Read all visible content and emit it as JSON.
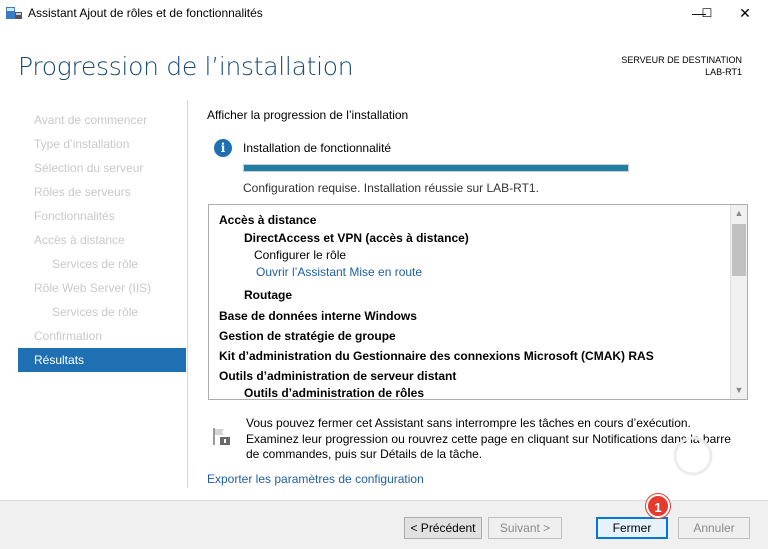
{
  "window": {
    "title": "Assistant Ajout de rôles et de fonctionnalités",
    "minimize": "—",
    "maximize": "☐",
    "close": "✕"
  },
  "header": {
    "title": "Progression de l’installation",
    "dest_label": "SERVEUR DE DESTINATION",
    "dest_server": "LAB-RT1"
  },
  "nav": {
    "items": [
      {
        "label": "Avant de commencer"
      },
      {
        "label": "Type d’installation"
      },
      {
        "label": "Sélection du serveur"
      },
      {
        "label": "Rôles de serveurs"
      },
      {
        "label": "Fonctionnalités"
      },
      {
        "label": "Accès à distance"
      },
      {
        "label": "Services de rôle"
      },
      {
        "label": "Rôle Web Server (IIS)"
      },
      {
        "label": "Services de rôle"
      },
      {
        "label": "Confirmation"
      },
      {
        "label": "Résultats"
      }
    ]
  },
  "main": {
    "section_label": "Afficher la progression de l’installation",
    "info_title": "Installation de fonctionnalité",
    "progress": 1.0,
    "status": "Configuration requise. Installation réussie sur LAB-RT1.",
    "results": [
      {
        "text": "Accès à distance"
      },
      {
        "text": "DirectAccess et VPN (accès à distance)"
      },
      {
        "text": "Configurer le rôle"
      },
      {
        "text": "Ouvrir l’Assistant Mise en route"
      },
      {
        "text": "Routage"
      },
      {
        "text": "Base de données interne Windows"
      },
      {
        "text": "Gestion de stratégie de groupe"
      },
      {
        "text": "Kit d’administration du Gestionnaire des connexions Microsoft (CMAK) RAS"
      },
      {
        "text": "Outils d’administration de serveur distant"
      },
      {
        "text": "Outils d’administration de rôles"
      }
    ],
    "note": "Vous pouvez fermer cet Assistant sans interrompre les tâches en cours d’exécution. Examinez leur progression ou rouvrez cette page en cliquant sur Notifications dans la barre de commandes, puis sur Détails de la tâche.",
    "export_link": "Exporter les paramètres de configuration"
  },
  "footer": {
    "prev": "< Précédent",
    "next": "Suivant >",
    "close": "Fermer",
    "cancel": "Annuler",
    "badge": "1"
  },
  "colors": {
    "accent": "#1f6fb3",
    "progress": "#1e7fa5",
    "link": "#1f5fa3",
    "badge": "#e73a2f"
  }
}
